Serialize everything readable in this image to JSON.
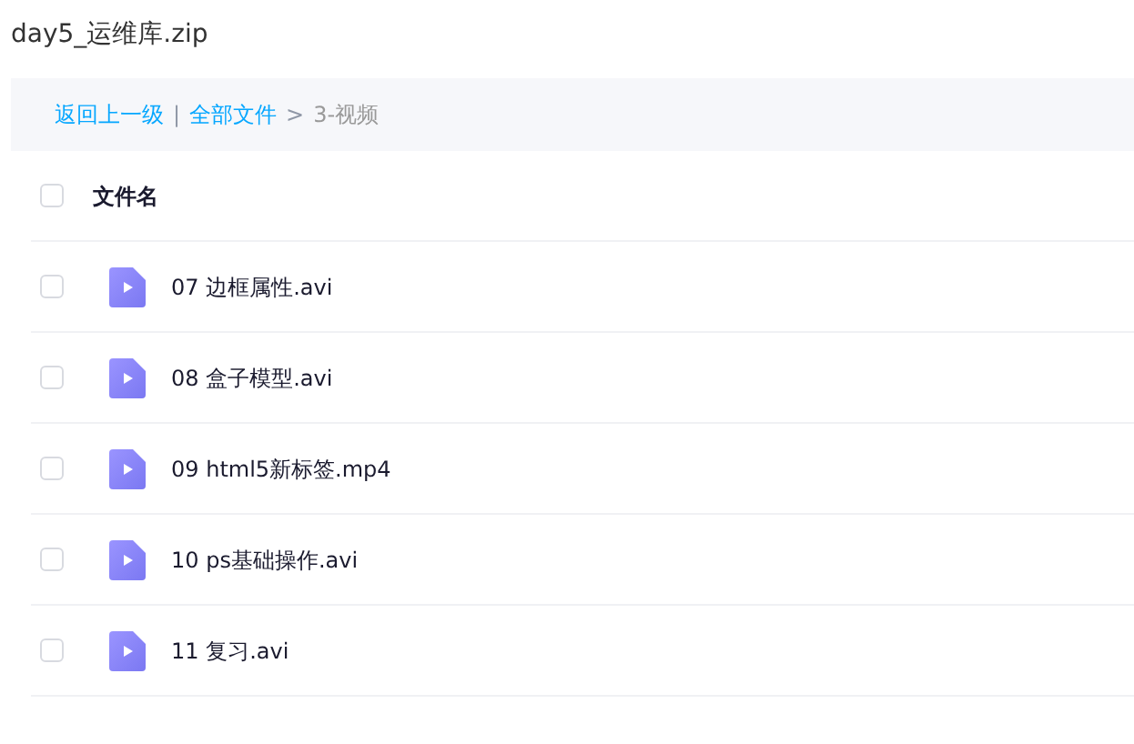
{
  "title": "day5_运维库.zip",
  "breadcrumb": [
    {
      "kind": "link",
      "text": "返回上一级"
    },
    {
      "kind": "divider",
      "text": "|"
    },
    {
      "kind": "link",
      "text": "全部文件"
    },
    {
      "kind": "separator",
      "text": ">"
    },
    {
      "kind": "current",
      "text": "3-视频"
    }
  ],
  "table": {
    "header": {
      "checked": false,
      "label": "文件名"
    },
    "rows": [
      {
        "checked": false,
        "name": "07 边框属性.avi"
      },
      {
        "checked": false,
        "name": "08 盒子模型.avi"
      },
      {
        "checked": false,
        "name": "09 html5新标签.mp4"
      },
      {
        "checked": false,
        "name": "10 ps基础操作.avi"
      },
      {
        "checked": false,
        "name": "11 复习.avi"
      }
    ]
  }
}
